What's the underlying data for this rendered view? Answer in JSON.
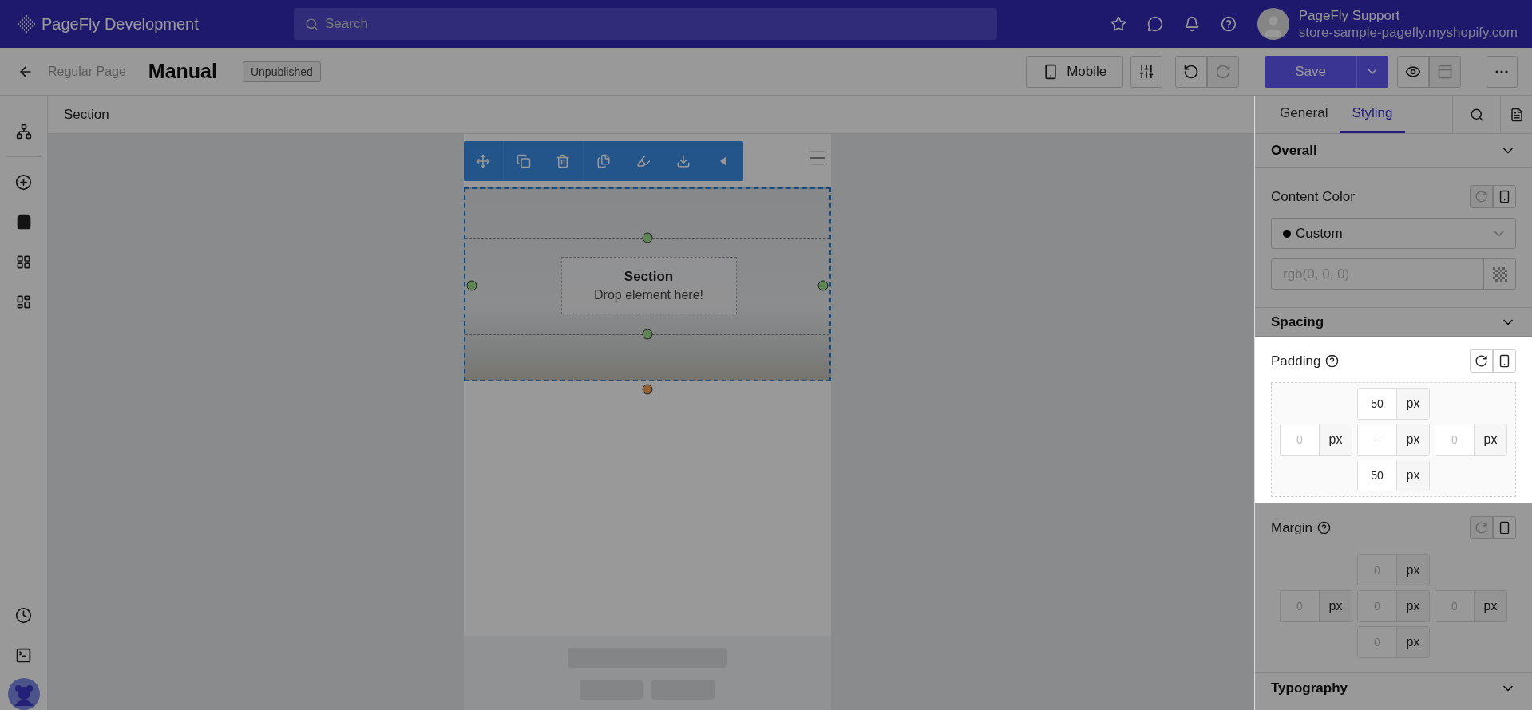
{
  "app": {
    "brand": "PageFly Development",
    "search_placeholder": "Search",
    "user": {
      "name": "PageFly Support",
      "store": "store-sample-pagefly.myshopify.com"
    }
  },
  "header": {
    "back_label": "Regular Page",
    "title": "Manual",
    "status": "Unpublished",
    "device": "Mobile",
    "save": "Save"
  },
  "breadcrumb": "Section",
  "canvas": {
    "section_title": "Section",
    "section_hint": "Drop element here!"
  },
  "inspector": {
    "tabs": [
      {
        "label": "General",
        "selected": false
      },
      {
        "label": "Styling",
        "selected": true
      }
    ],
    "overall": {
      "title": "Overall",
      "label": "Content Color",
      "option": "Custom",
      "color": "#000000",
      "placeholder": "rgb(0, 0, 0)",
      "reset_disabled": true
    },
    "spacing": {
      "title": "Spacing",
      "groups": [
        {
          "label": "Padding",
          "highlighted": true,
          "reset_disabled": false,
          "boxes": [
            {
              "value": "50",
              "unit": "px"
            },
            {
              "placeholder": "0",
              "unit": "px"
            },
            {
              "placeholder": "--",
              "unit": "px"
            },
            {
              "placeholder": "0",
              "unit": "px"
            },
            {
              "value": "50",
              "unit": "px"
            }
          ]
        },
        {
          "label": "Margin",
          "highlighted": false,
          "reset_disabled": true,
          "boxes": [
            {
              "placeholder": "0",
              "unit": "px"
            },
            {
              "placeholder": "0",
              "unit": "px"
            },
            {
              "placeholder": "0",
              "unit": "px"
            },
            {
              "placeholder": "0",
              "unit": "px"
            },
            {
              "placeholder": "0",
              "unit": "px"
            }
          ]
        }
      ]
    },
    "typography": {
      "title": "Typography"
    }
  }
}
